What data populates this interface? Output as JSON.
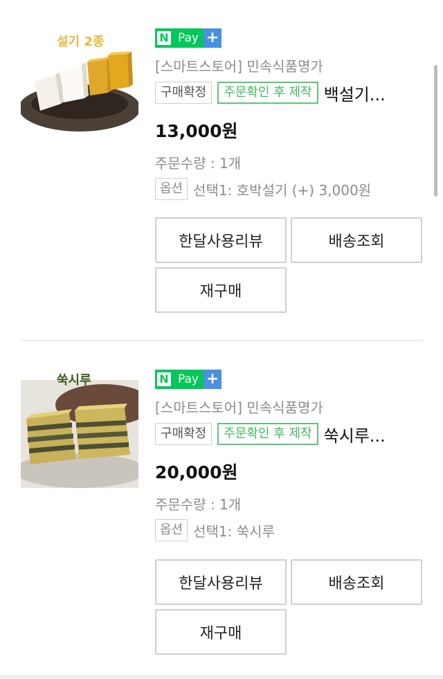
{
  "orders": [
    {
      "image_caption": "설기 2종",
      "npay": {
        "n": "N",
        "pay": "Pay",
        "plus": "+"
      },
      "store": "[스마트스토어] 민속식품명가",
      "status_tag": "구매확정",
      "production_tag": "주문확인 후 제작",
      "product_name": "백설기...",
      "price": "13,000원",
      "quantity": "주문수량 : 1개",
      "option_badge": "옵션",
      "option_text": "선택1: 호박설기 (+) 3,000원",
      "buttons": {
        "review": "한달사용리뷰",
        "tracking": "배송조회",
        "rebuy": "재구매"
      }
    },
    {
      "image_caption": "쑥시루",
      "npay": {
        "n": "N",
        "pay": "Pay",
        "plus": "+"
      },
      "store": "[스마트스토어] 민속식품명가",
      "status_tag": "구매확정",
      "production_tag": "주문확인 후 제작",
      "product_name": "쑥시루...",
      "price": "20,000원",
      "quantity": "주문수량 : 1개",
      "option_badge": "옵션",
      "option_text": "선택1: 쑥시루",
      "buttons": {
        "review": "한달사용리뷰",
        "tracking": "배송조회",
        "rebuy": "재구매"
      }
    }
  ],
  "colors": {
    "npay_green": "#03c75a",
    "npay_blue": "#4a90e2",
    "tag_green": "#3fb85e",
    "muted": "#8c8c8c"
  }
}
